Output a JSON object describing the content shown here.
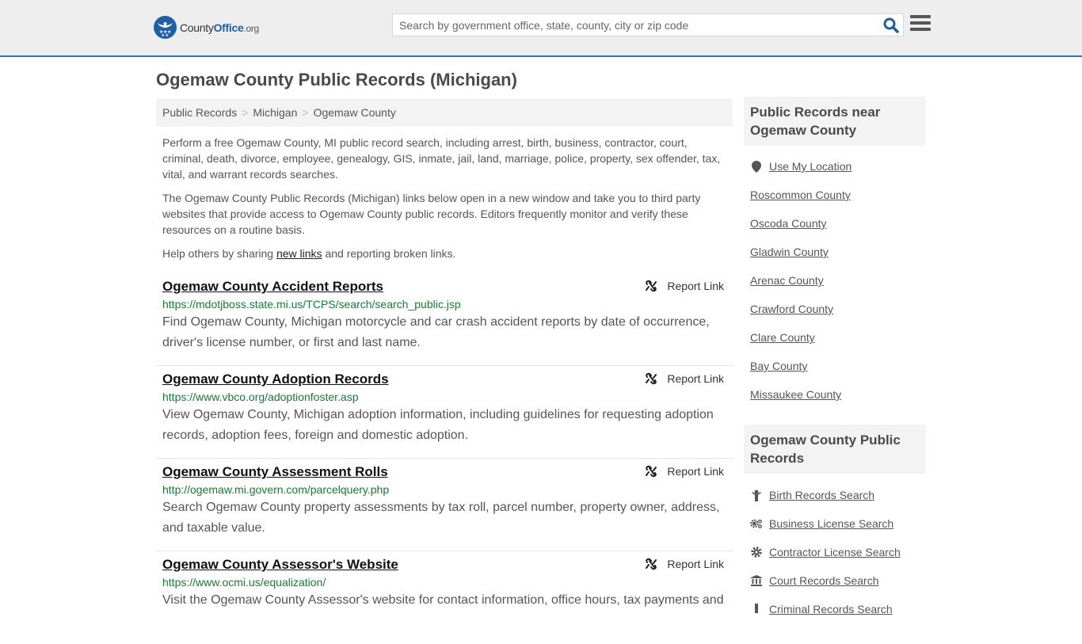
{
  "header": {
    "logo": {
      "county": "County",
      "office": "Office",
      "org": ".org"
    },
    "search": {
      "placeholder": "Search by government office, state, county, city or zip code",
      "value": ""
    },
    "icons": {
      "search": "search-icon",
      "menu": "hamburger-menu-icon"
    }
  },
  "page": {
    "title": "Ogemaw County Public Records (Michigan)"
  },
  "breadcrumb": [
    {
      "label": "Public Records"
    },
    {
      "label": "Michigan"
    },
    {
      "label": "Ogemaw County"
    }
  ],
  "breadcrumb_separator": ">",
  "intro": {
    "p1": "Perform a free Ogemaw County, MI public record search, including arrest, birth, business, contractor, court, criminal, death, divorce, employee, genealogy, GIS, inmate, jail, land, marriage, police, property, sex offender, tax, vital, and warrant records searches.",
    "p2": "The Ogemaw County Public Records (Michigan) links below open in a new window and take you to third party websites that provide access to Ogemaw County public records. Editors frequently monitor and verify these resources on a routine basis.",
    "p3_before": "Help others by sharing ",
    "p3_link": "new links",
    "p3_after": " and reporting broken links."
  },
  "records": [
    {
      "title": "Ogemaw County Accident Reports",
      "url": "https://mdotjboss.state.mi.us/TCPS/search/search_public.jsp",
      "description": "Find Ogemaw County, Michigan motorcycle and car crash accident reports by date of occurrence, driver's license number, or first and last name.",
      "report_label": "Report Link"
    },
    {
      "title": "Ogemaw County Adoption Records",
      "url": "https://www.vbco.org/adoptionfoster.asp",
      "description": "View Ogemaw County, Michigan adoption information, including guidelines for requesting adoption records, adoption fees, foreign and domestic adoption.",
      "report_label": "Report Link"
    },
    {
      "title": "Ogemaw County Assessment Rolls",
      "url": "http://ogemaw.mi.govern.com/parcelquery.php",
      "description": "Search Ogemaw County property assessments by tax roll, parcel number, property owner, address, and taxable value.",
      "report_label": "Report Link"
    },
    {
      "title": "Ogemaw County Assessor's Website",
      "url": "https://www.ocmi.us/equalization/",
      "description": "Visit the Ogemaw County Assessor's website for contact information, office hours, tax payments and",
      "report_label": "Report Link"
    }
  ],
  "sidebar": {
    "nearby": {
      "heading": "Public Records near Ogemaw County",
      "items": [
        {
          "label": "Use My Location",
          "icon": "map-marker-icon"
        },
        {
          "label": "Roscommon County"
        },
        {
          "label": "Oscoda County"
        },
        {
          "label": "Gladwin County"
        },
        {
          "label": "Arenac County"
        },
        {
          "label": "Crawford County"
        },
        {
          "label": "Clare County"
        },
        {
          "label": "Bay County"
        },
        {
          "label": "Missaukee County"
        }
      ]
    },
    "county_records": {
      "heading": "Ogemaw County Public Records",
      "items": [
        {
          "label": "Birth Records Search",
          "icon": "baby-icon"
        },
        {
          "label": "Business License Search",
          "icon": "gears-icon"
        },
        {
          "label": "Contractor License Search",
          "icon": "gear-icon"
        },
        {
          "label": "Court Records Search",
          "icon": "courthouse-icon"
        },
        {
          "label": "Criminal Records Search",
          "icon": "criminal-icon"
        }
      ]
    }
  },
  "colors": {
    "brand_blue": "#1f5fa6",
    "header_border": "#2a75b3",
    "url_green": "#1a7a35",
    "panel_gray": "#f3f3f3"
  }
}
